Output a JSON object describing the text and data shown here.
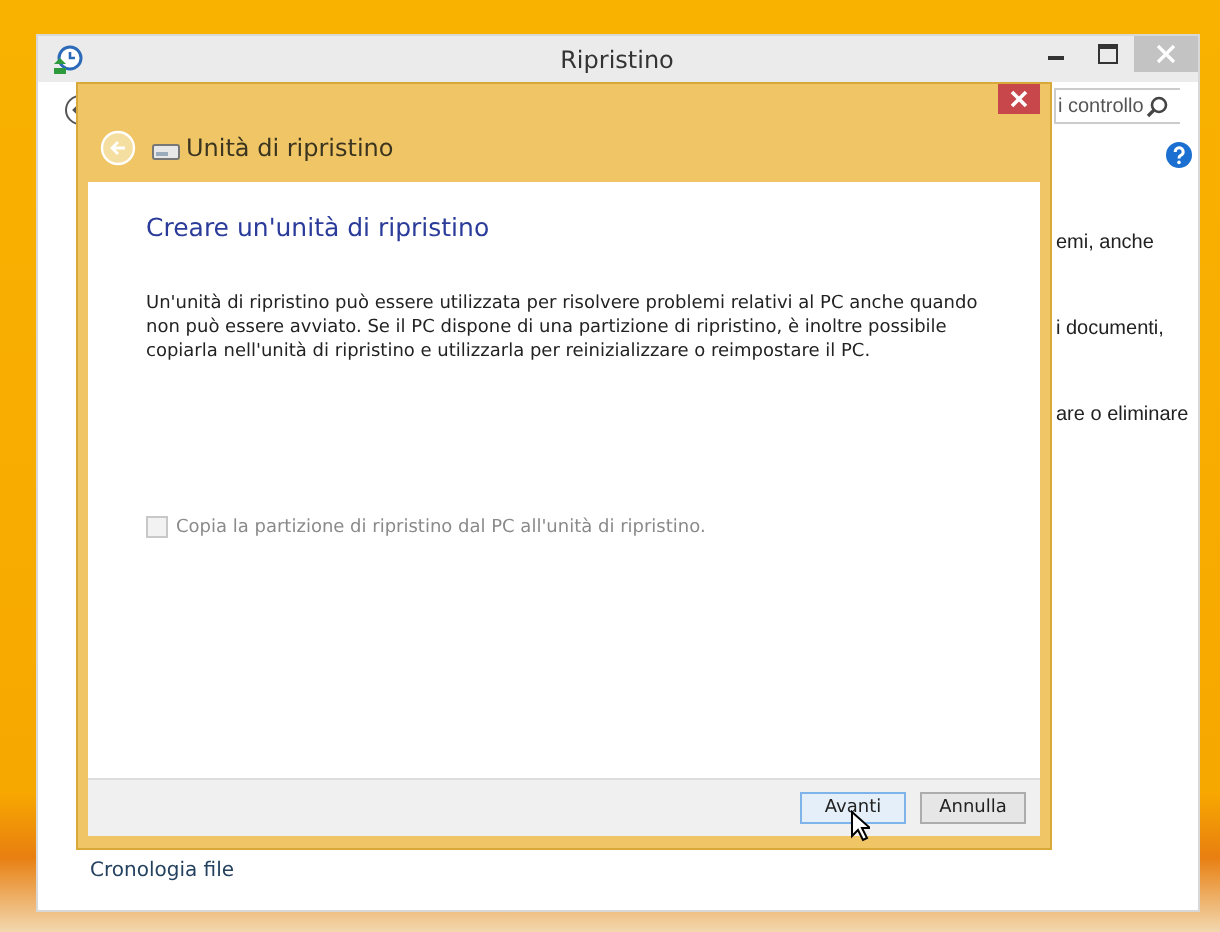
{
  "window": {
    "title": "Ripristino"
  },
  "background_window": {
    "search": {
      "value": "i controllo"
    },
    "texts": [
      "emi, anche",
      "i documenti,",
      "are o eliminare"
    ],
    "link": "Cronologia file"
  },
  "dialog": {
    "title": "Unità di ripristino",
    "heading": "Creare un'unità di ripristino",
    "description": "Un'unità di ripristino può essere utilizzata per risolvere problemi relativi al PC anche quando non può essere avviato. Se il PC dispone di una partizione di ripristino, è inoltre possibile copiarla nell'unità di ripristino e utilizzarla per reinizializzare o reimpostare il PC.",
    "checkbox": {
      "label": "Copia la partizione di ripristino dal PC all'unità di ripristino.",
      "checked": false,
      "disabled": true
    },
    "buttons": [
      {
        "label": "Avanti",
        "focused": true
      },
      {
        "label": "Annulla",
        "focused": false
      }
    ]
  }
}
